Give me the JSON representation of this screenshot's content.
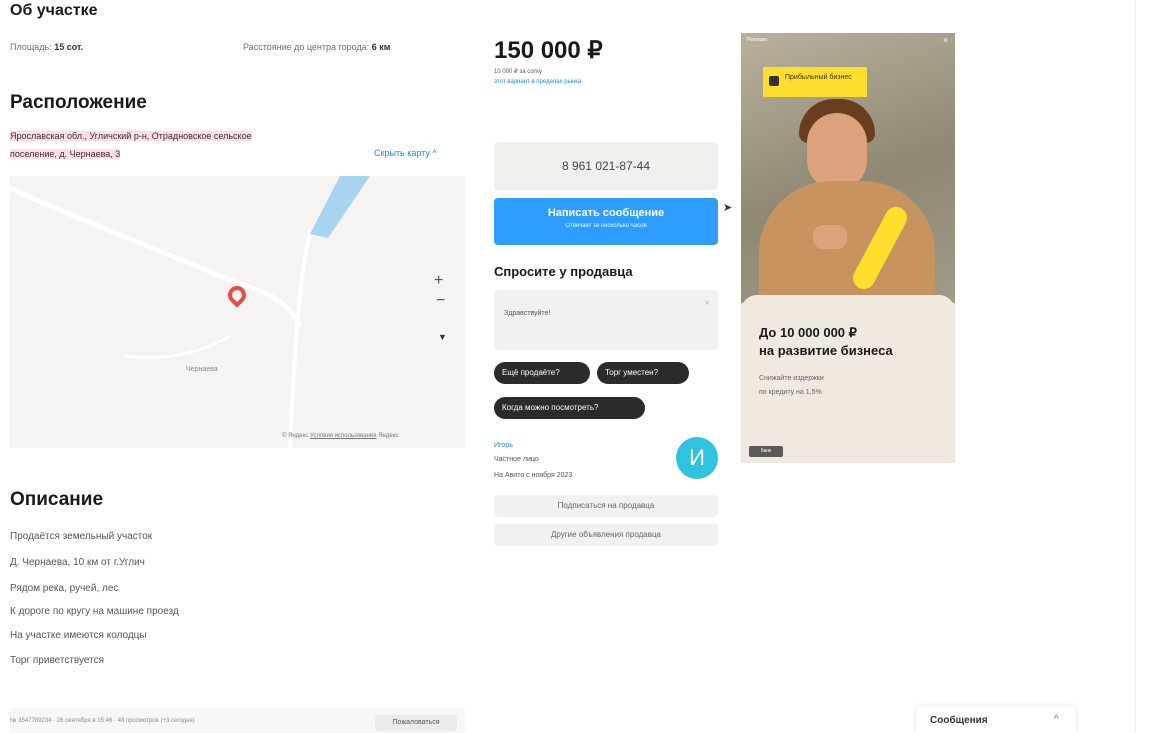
{
  "plot": {
    "heading": "Об участке",
    "area_label": "Площадь:",
    "area_value": "15 сот.",
    "distance_label": "Расстояние до центра города:",
    "distance_value": "6 км"
  },
  "location": {
    "heading": "Расположение",
    "address_line1": "Ярославская обл., Угличский р-н, Отрадновское сельское",
    "address_line2": "поселение, д. Чернаева, 3",
    "hide_map": "Скрыть карту ^",
    "map_village": "Чернаева",
    "map_copyright": "© Яндекс",
    "map_terms": "Условия использования",
    "map_brand": "Яндекс",
    "zoom_in": "+",
    "zoom_out": "−",
    "locate": "▼"
  },
  "description": {
    "heading": "Описание",
    "lines": [
      "Продаётся земельный участок",
      "Д. Чернаева, 10 км от г.Углич",
      "Рядом река, ручей, лес",
      "К дороге по кругу на машине проезд",
      "На участке имеются колодцы",
      "Торг приветствуется"
    ]
  },
  "footer": {
    "meta": "№ 3547789234 · 26 сентября в 15:46 · 48 просмотров (+3 сегодня)",
    "report_button": "Пожаловаться"
  },
  "price": {
    "value": "150 000 ₽",
    "per_unit": "10 000 ₽ за сотку",
    "market_link": "этот вариант в пределах рынка"
  },
  "contact": {
    "phone": "8 961 021-87-44",
    "write_button": "Написать сообщение",
    "write_sub": "Отвечает за несколько часов"
  },
  "ask": {
    "heading": "Спросите у продавца",
    "input_value": "Здравствуйте!",
    "chips": [
      "Ещё продаёте?",
      "Торг уместен?",
      "Когда можно посмотреть?"
    ]
  },
  "seller": {
    "name": "Игорь",
    "type": "Частное лицо",
    "since": "На Авито с ноября 2023",
    "avatar_letter": "И",
    "avatar_color": "#2fc3e0",
    "subscribe_button": "Подписаться на продавца",
    "other_ads_button": "Другие объявления продавца"
  },
  "ad": {
    "badge": "Реклама",
    "close": "×",
    "chip": "Прибыльный бизнес",
    "headline1": "До 10 000 000 ₽",
    "headline2": "на развитие бизнеса",
    "sub1": "Снижайте издержки",
    "sub2": "по кредиту на 1,5%",
    "logo": "банк",
    "accent_color": "#ffdd2d"
  },
  "messages": {
    "label": "Сообщения",
    "toggle": "^"
  },
  "colors": {
    "highlight": "#ffdde8",
    "primary_button": "#2d9eff",
    "map_pin": "#e94b4b",
    "dark_chip": "#2b2b2b"
  }
}
